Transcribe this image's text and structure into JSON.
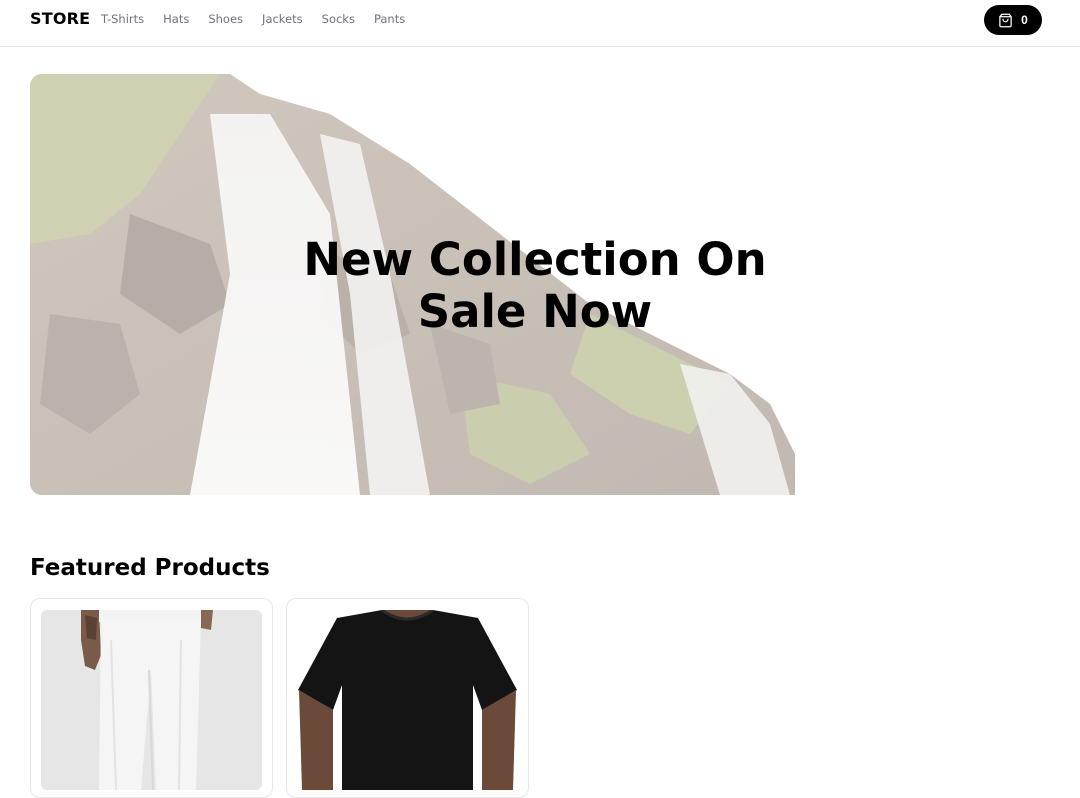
{
  "header": {
    "brand": "STORE",
    "nav": [
      "T-Shirts",
      "Hats",
      "Shoes",
      "Jackets",
      "Socks",
      "Pants"
    ],
    "cart_count": "0",
    "cart_icon": "shopping-bag-icon"
  },
  "hero": {
    "title": "New Collection On\nSale Now",
    "image": "waterfall-image"
  },
  "featured": {
    "title": "Featured Products",
    "products": [
      {
        "image": "white-pants-image"
      },
      {
        "image": "black-tshirt-image"
      }
    ]
  },
  "colors": {
    "accent": "#000000",
    "nav_text": "#6b7280",
    "border": "#e5e7eb",
    "background": "#ffffff"
  }
}
